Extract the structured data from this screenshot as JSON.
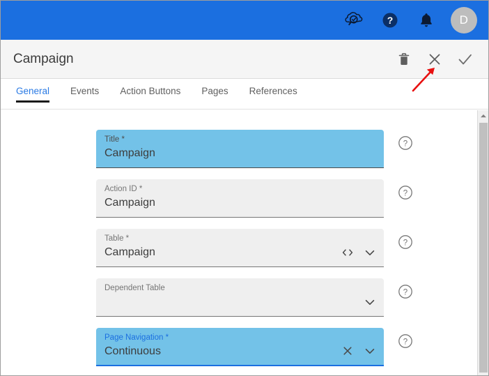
{
  "appbar": {
    "background": "#1b6fe0",
    "icons": [
      {
        "name": "cloud-search-icon",
        "label": "Cloud Search"
      },
      {
        "name": "help-circle-icon",
        "label": "Help"
      },
      {
        "name": "notification-bell-icon",
        "label": "Notifications"
      }
    ],
    "avatar": {
      "initial": "D",
      "background": "#bdbdbd"
    }
  },
  "titlebar": {
    "title": "Campaign",
    "actions": [
      {
        "name": "delete-button",
        "label": "Delete"
      },
      {
        "name": "close-button",
        "label": "Close"
      },
      {
        "name": "confirm-button",
        "label": "Confirm"
      }
    ]
  },
  "tabs": [
    {
      "label": "General",
      "active": true
    },
    {
      "label": "Events",
      "active": false
    },
    {
      "label": "Action Buttons",
      "active": false
    },
    {
      "label": "Pages",
      "active": false
    },
    {
      "label": "References",
      "active": false
    }
  ],
  "form": {
    "fields": [
      {
        "name": "title",
        "label": "Title *",
        "value": "Campaign",
        "placeholder": "Title",
        "state": "filled-blue",
        "adornments": [],
        "help": "?"
      },
      {
        "name": "action-id",
        "label": "Action ID *",
        "value": "Campaign",
        "placeholder": "Action ID",
        "state": "default",
        "adornments": [],
        "help": "?"
      },
      {
        "name": "table",
        "label": "Table *",
        "value": "Campaign",
        "placeholder": "Table",
        "state": "default",
        "adornments": [
          "code-icon",
          "chevron-down-icon"
        ],
        "help": "?"
      },
      {
        "name": "dependent-table",
        "label": "Dependent Table",
        "value": "",
        "placeholder": "Dependent Table",
        "state": "default",
        "adornments": [
          "chevron-down-icon"
        ],
        "help": "?"
      },
      {
        "name": "page-navigation",
        "label": "Page Navigation *",
        "value": "Continuous",
        "placeholder": "Page Navigation",
        "state": "focused-blue",
        "adornments": [
          "clear-x-icon",
          "chevron-down-icon"
        ],
        "help": "?"
      }
    ]
  },
  "scrollbar": {
    "name": "vertical-scrollbar",
    "up_arrow": "scroll-up-arrow"
  },
  "annotation": {
    "name": "red-pointer-arrow",
    "color": "#e81010",
    "points_to": "close-button"
  },
  "colors": {
    "appbar_blue": "#1b6fe0",
    "field_blue": "#73c2e8",
    "tab_active_blue": "#2a7ae4",
    "field_gray": "#efefef",
    "annotation_red": "#e81010"
  }
}
